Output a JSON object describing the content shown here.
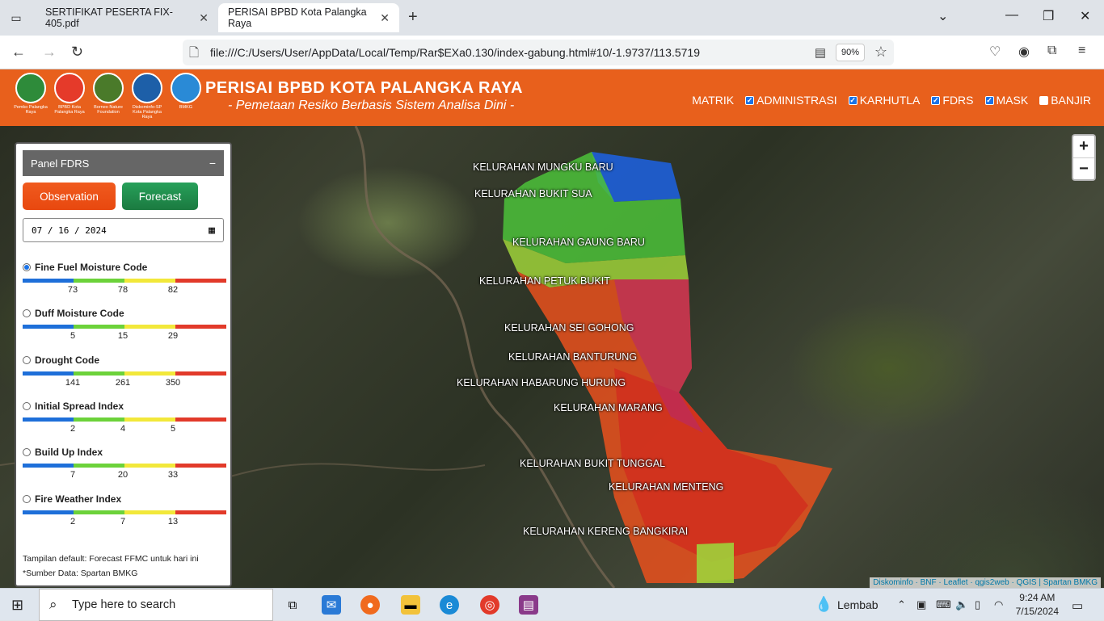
{
  "browser": {
    "tabs": [
      {
        "label": "SERTIFIKAT PESERTA FIX-405.pdf"
      },
      {
        "label": "PERISAI BPBD Kota Palangka Raya"
      }
    ],
    "url": "file:///C:/Users/User/AppData/Local/Temp/Rar$EXa0.130/index-gabung.html#10/-1.9737/113.5719",
    "zoom": "90%"
  },
  "header": {
    "logos": [
      {
        "caption": "Pemko Palangka Raya",
        "color": "#2e8b3a"
      },
      {
        "caption": "BPBD Kota Palangka Raya",
        "color": "#e53a2a"
      },
      {
        "caption": "Borneo Nature Foundation",
        "color": "#4a7a2a"
      },
      {
        "caption": "Diskominfo-SP Kota Palangka Raya",
        "color": "#1d5fa8"
      },
      {
        "caption": "BMKG",
        "color": "#2a8ad6"
      }
    ],
    "title": "PERISAI BPBD KOTA PALANGKA RAYA",
    "subtitle": "- Pemetaan Resiko Berbasis Sistem Analisa Dini -",
    "menu": {
      "matrik": "MATRIK",
      "administrasi": "ADMINISTRASI",
      "karhutla": "KARHUTLA",
      "fdrs": "FDRS",
      "mask": "MASK",
      "banjir": "BANJIR"
    }
  },
  "panel": {
    "title": "Panel FDRS",
    "minimize": "−",
    "observation_label": "Observation",
    "forecast_label": "Forecast",
    "date": "07 / 16 / 2024",
    "indices": [
      {
        "name": "Fine Fuel Moisture Code",
        "selected": true,
        "ticks": [
          "73",
          "78",
          "82"
        ]
      },
      {
        "name": "Duff Moisture Code",
        "selected": false,
        "ticks": [
          "5",
          "15",
          "29"
        ]
      },
      {
        "name": "Drought Code",
        "selected": false,
        "ticks": [
          "141",
          "261",
          "350"
        ]
      },
      {
        "name": "Initial Spread Index",
        "selected": false,
        "ticks": [
          "2",
          "4",
          "5"
        ]
      },
      {
        "name": "Build Up Index",
        "selected": false,
        "ticks": [
          "7",
          "20",
          "33"
        ]
      },
      {
        "name": "Fire Weather Index",
        "selected": false,
        "ticks": [
          "2",
          "7",
          "13"
        ]
      }
    ],
    "scale_colors": [
      "#1e6fd9",
      "#6cd23a",
      "#f2e83a",
      "#e23a2a"
    ],
    "note1": "Tampilan default: Forecast FFMC untuk hari ini",
    "note2": "*Sumber Data: Spartan BMKG"
  },
  "map": {
    "kelurahan": [
      "KELURAHAN MUNGKU BARU",
      "KELURAHAN BUKIT SUA",
      "KELURAHAN GAUNG BARU",
      "KELURAHAN PETUK BUKIT",
      "KELURAHAN SEI GOHONG",
      "KELURAHAN BANTURUNG",
      "KELURAHAN HABARUNG HURUNG",
      "KELURAHAN MARANG",
      "KELURAHAN BUKIT TUNGGAL",
      "KELURAHAN MENTENG",
      "KELURAHAN KERENG BANGKIRAI"
    ],
    "attribution": "Diskominfo · BNF · Leaflet · qgis2web · QGIS | Spartan BMKG"
  },
  "taskbar": {
    "search_placeholder": "Type here to search",
    "weather": "Lembab",
    "time": "9:24 AM",
    "date": "7/15/2024"
  }
}
